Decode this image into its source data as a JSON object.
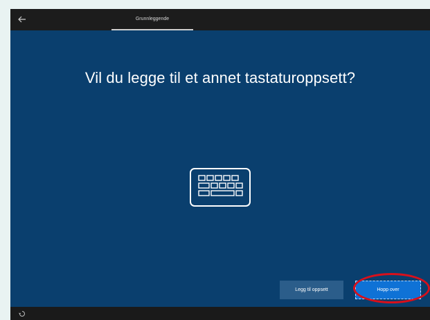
{
  "topbar": {
    "back_icon": "back-arrow-icon",
    "tab_label": "Grunnleggende"
  },
  "main": {
    "title": "Vil du legge til et annet tastaturoppsett?",
    "illustration_icon": "keyboard-icon"
  },
  "actions": {
    "add_layout_label": "Legg til oppsett",
    "skip_label": "Hopp over"
  },
  "annotation": {
    "highlight_color": "#d8101b"
  },
  "bottombar": {
    "accessibility_icon": "ease-of-access-icon"
  },
  "colors": {
    "background": "#0a3f6e",
    "topbar": "#1c1c1c",
    "primary_button": "#0f72d6",
    "secondary_button": "#2b5d8a"
  }
}
